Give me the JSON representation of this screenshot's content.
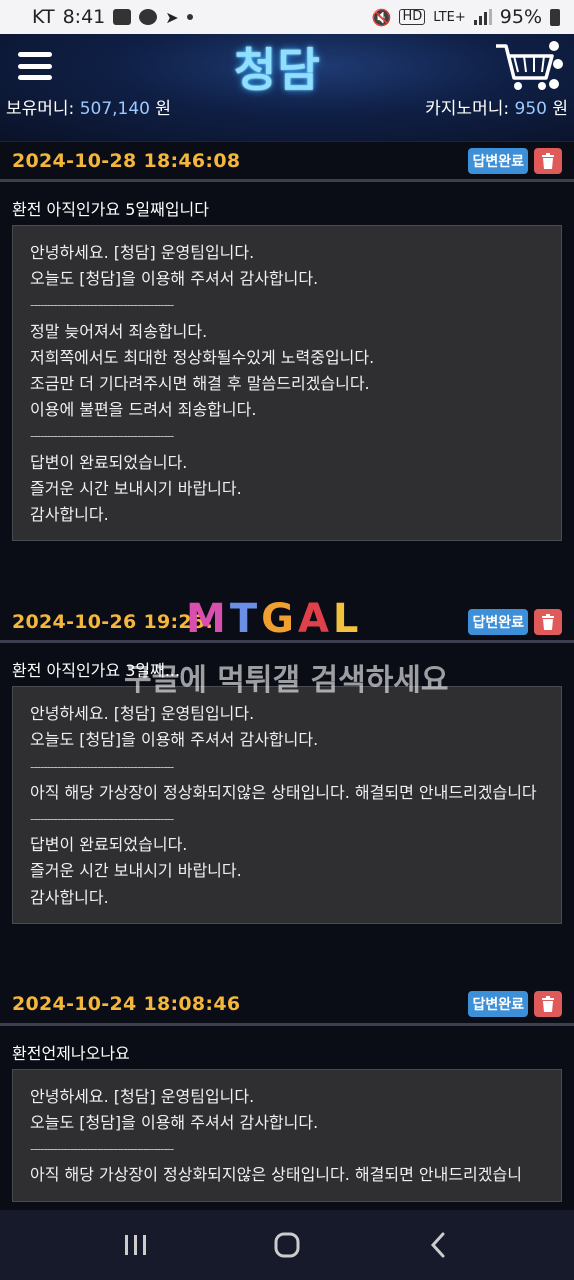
{
  "status_bar": {
    "carrier": "KT",
    "time": "8:41",
    "network": "LTE+",
    "hd": "HD",
    "battery": "95%"
  },
  "header": {
    "logo": "청담",
    "held_money_label": "보유머니:",
    "held_money_value": "507,140",
    "held_money_unit": "원",
    "casino_money_label": "카지노머니:",
    "casino_money_value": "950",
    "casino_money_unit": "원"
  },
  "icons": {
    "menu": "hamburger-menu-icon",
    "cart": "shopping-cart-icon",
    "trash": "trash-icon"
  },
  "colors": {
    "date": "#f4b73b",
    "badge": "#3d8fd7",
    "trash": "#e05a5a"
  },
  "posts": [
    {
      "date": "2024-10-28 18:46:08",
      "badge": "답변완료",
      "title": "환전 아직인가요 5일째입니다",
      "lines": [
        "안녕하세요. [청담] 운영팀입니다.",
        "오늘도 [청담]을 이용해 주셔서 감사합니다.",
        "-------------------------------------------",
        "정말 늦어져서 죄송합니다.",
        "저희쪽에서도 최대한 정상화될수있게 노력중입니다.",
        "조금만 더 기다려주시면 해결 후 말씀드리겠습니다.",
        "이용에 불편을 드려서 죄송합니다.",
        "-------------------------------------------",
        "답변이 완료되었습니다.",
        "즐거운 시간 보내시기 바랍니다.",
        "감사합니다."
      ]
    },
    {
      "date": "2024-10-26 19:25:",
      "badge": "답변완료",
      "title": "환전 아직인가요 3일째...",
      "lines": [
        "안녕하세요. [청담] 운영팀입니다.",
        "오늘도 [청담]을 이용해 주셔서 감사합니다.",
        "-------------------------------------------",
        "아직 해당 가상장이 정상화되지않은 상태입니다. 해결되면 안내드리겠습니다",
        "-------------------------------------------",
        "답변이 완료되었습니다.",
        "즐거운 시간 보내시기 바랍니다.",
        "감사합니다."
      ]
    },
    {
      "date": "2024-10-24 18:08:46",
      "badge": "답변완료",
      "title": "환전언제나오나요",
      "lines": [
        "안녕하세요. [청담] 운영팀입니다.",
        "오늘도 [청담]을 이용해 주셔서 감사합니다.",
        "-------------------------------------------",
        "아직 해당 가상장이 정상화되지않은 상태입니다. 해결되면 안내드리겠습니"
      ]
    }
  ],
  "watermark": {
    "logo": "MTGAL",
    "text": "구글에 먹튀갤 검색하세요"
  }
}
